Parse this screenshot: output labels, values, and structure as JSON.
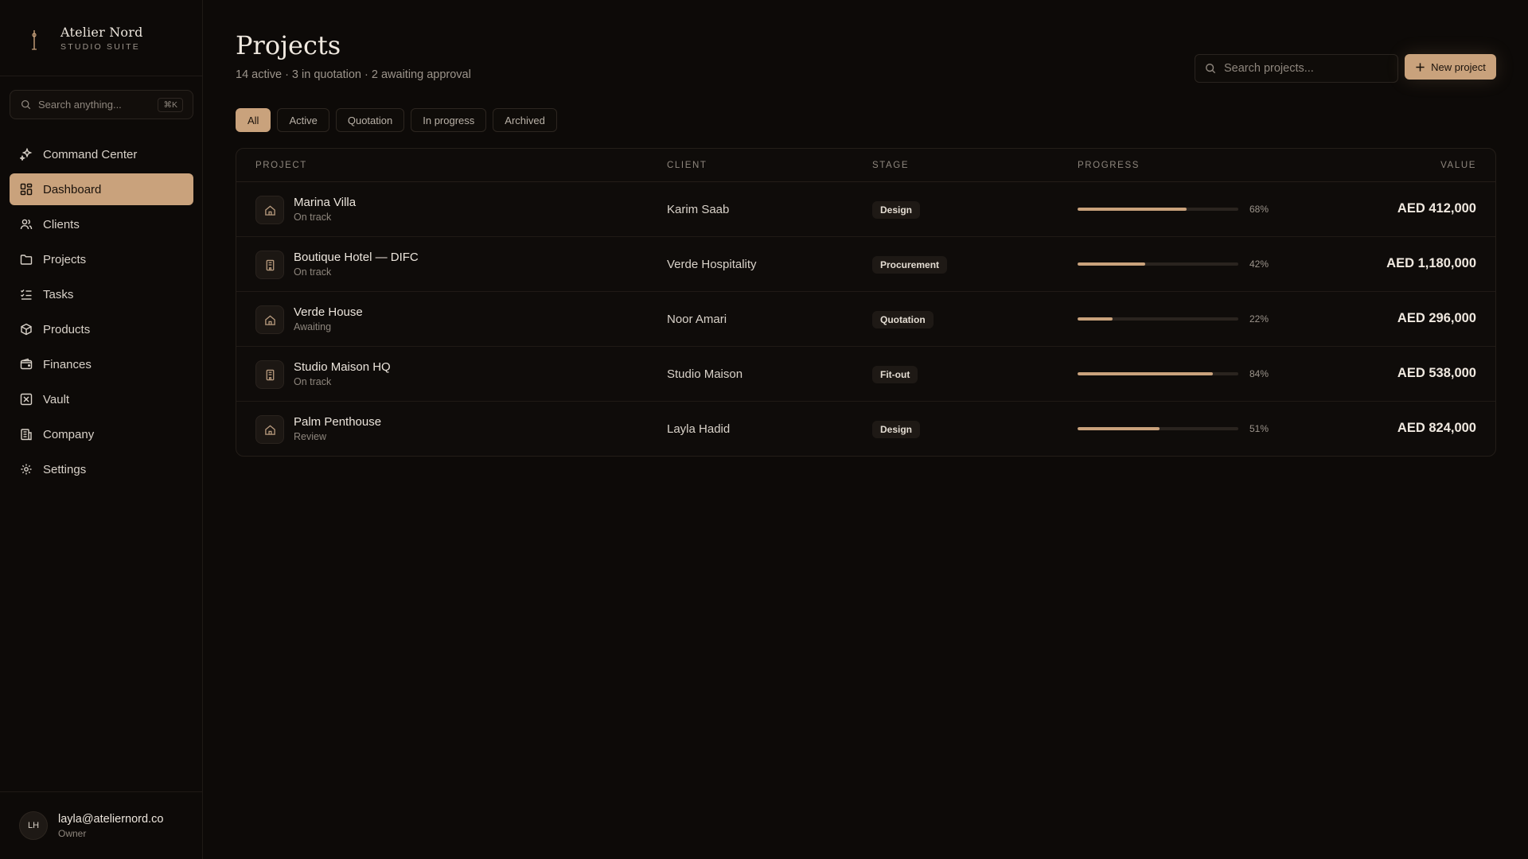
{
  "brand": {
    "name": "Atelier Nord",
    "subtitle": "STUDIO SUITE"
  },
  "sidebar_search": {
    "placeholder": "Search anything...",
    "shortcut": "⌘K"
  },
  "nav": [
    {
      "label": "Command Center",
      "icon": "sparkle-icon"
    },
    {
      "label": "Dashboard",
      "icon": "grid-icon",
      "active": true
    },
    {
      "label": "Clients",
      "icon": "users-icon"
    },
    {
      "label": "Projects",
      "icon": "folder-icon"
    },
    {
      "label": "Tasks",
      "icon": "list-checks-icon"
    },
    {
      "label": "Products",
      "icon": "package-icon"
    },
    {
      "label": "Finances",
      "icon": "wallet-icon"
    },
    {
      "label": "Vault",
      "icon": "vault-icon"
    },
    {
      "label": "Company",
      "icon": "building-icon"
    },
    {
      "label": "Settings",
      "icon": "gear-icon"
    }
  ],
  "user": {
    "initials": "LH",
    "email": "layla@ateliernord.co",
    "role": "Owner"
  },
  "page": {
    "title": "Projects",
    "subtitle": "14 active · 3 in quotation · 2 awaiting approval"
  },
  "search": {
    "placeholder": "Search projects..."
  },
  "new_button": {
    "label": "New project"
  },
  "filters": [
    "All",
    "Active",
    "Quotation",
    "In progress",
    "Archived"
  ],
  "active_filter": "All",
  "table": {
    "columns": {
      "project": "PROJECT",
      "client": "CLIENT",
      "stage": "STAGE",
      "progress": "PROGRESS",
      "value": "VALUE"
    },
    "rows": [
      {
        "name": "Marina Villa",
        "status": "On track",
        "client": "Karim Saab",
        "stage": "Design",
        "progress": 68,
        "progress_label": "68%",
        "value": "AED 412,000",
        "icon": "home-icon"
      },
      {
        "name": "Boutique Hotel — DIFC",
        "status": "On track",
        "client": "Verde Hospitality",
        "stage": "Procurement",
        "progress": 42,
        "progress_label": "42%",
        "value": "AED 1,180,000",
        "icon": "building-icon"
      },
      {
        "name": "Verde House",
        "status": "Awaiting",
        "client": "Noor Amari",
        "stage": "Quotation",
        "progress": 22,
        "progress_label": "22%",
        "value": "AED 296,000",
        "icon": "home-icon"
      },
      {
        "name": "Studio Maison HQ",
        "status": "On track",
        "client": "Studio Maison",
        "stage": "Fit-out",
        "progress": 84,
        "progress_label": "84%",
        "value": "AED 538,000",
        "icon": "building-icon"
      },
      {
        "name": "Palm Penthouse",
        "status": "Review",
        "client": "Layla Hadid",
        "stage": "Design",
        "progress": 51,
        "progress_label": "51%",
        "value": "AED 824,000",
        "icon": "home-icon"
      }
    ]
  },
  "colors": {
    "accent": "#c9a27c",
    "background": "#0d0a08",
    "panel": "#0f0c0a"
  }
}
